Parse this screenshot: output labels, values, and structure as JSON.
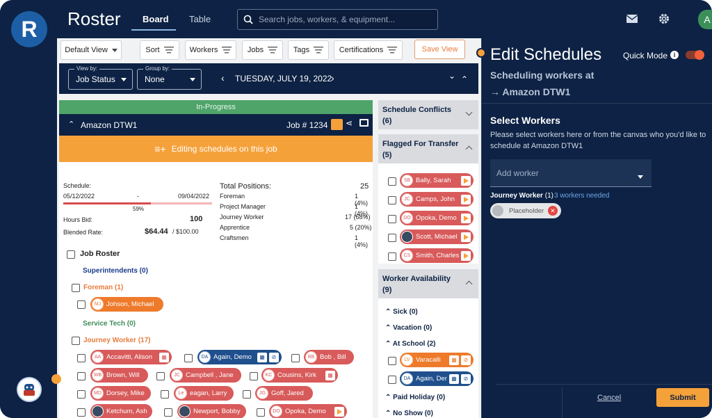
{
  "app": {
    "logo_letter": "R",
    "title": "Roster",
    "tabs": [
      "Board",
      "Table"
    ],
    "search_placeholder": "Search jobs, workers, & equipment...",
    "avatar_letter": "A"
  },
  "filters": {
    "default_view": "Default View",
    "sort": "Sort",
    "workers": "Workers",
    "jobs": "Jobs",
    "tags": "Tags",
    "certifications": "Certifications",
    "save_view": "Save View"
  },
  "nav": {
    "view_by_caption": "View by:",
    "view_by_value": "Job Status",
    "group_by_caption": "Group by:",
    "group_by_value": "None",
    "date": "TUESDAY, JULY 19, 2022"
  },
  "job": {
    "status": "In-Progress",
    "name": "Amazon DTW1",
    "number": "Job # 1234",
    "editing": "Editing schedules on this job",
    "schedule_label": "Schedule:",
    "start": "05/12/2022",
    "dash": "-",
    "end": "09/04/2022",
    "progress_pct": "59%",
    "progress": 0.59,
    "hours_bid_label": "Hours Bid:",
    "hours_bid": "100",
    "blended_label": "Blended Rate:",
    "blended_value": "$64.44",
    "blended_rest": "/ $100.00",
    "positions_label": "Total Positions:",
    "positions_total": "25",
    "positions": [
      {
        "name": "Foreman",
        "value": "1 (4%)"
      },
      {
        "name": "Project Manager",
        "value": "1 (4%)"
      },
      {
        "name": "Journey Worker",
        "value": "17 (68%)"
      },
      {
        "name": "Apprentice",
        "value": "5 (20%)"
      },
      {
        "name": "Craftsmen",
        "value": "1 (4%)"
      }
    ]
  },
  "roster": {
    "title": "Job Roster",
    "superintendents": "Superintendents (0)",
    "foreman": "Foreman (1)",
    "foreman_worker": {
      "initials": "MJ",
      "name": "Johson, Michael"
    },
    "service_tech": "Service Tech (0)",
    "journey": "Journey Worker (17)",
    "rows": [
      [
        {
          "initials": "AA",
          "name": "Accavitti, Alison"
        },
        {
          "initials": "DA",
          "name": "Again, Demo"
        },
        {
          "initials": "BB",
          "name": "Bob , Bill"
        }
      ],
      [
        {
          "initials": "WB",
          "name": "Brown, Will"
        },
        {
          "initials": "JC",
          "name": "Campbell , Jane"
        },
        {
          "initials": "KC",
          "name": "Cousins, Kirk"
        }
      ],
      [
        {
          "initials": "MD",
          "name": "Dorsey, Mike"
        },
        {
          "initials": "Le",
          "name": "eagan, Larry"
        },
        {
          "initials": "JG",
          "name": "Goff, Jared"
        }
      ],
      [
        {
          "initials": "",
          "name": "Ketchum, Ash"
        },
        {
          "initials": "",
          "name": "Newport, Bobby"
        },
        {
          "initials": "DO",
          "name": "Opoka, Demo"
        }
      ]
    ]
  },
  "side": {
    "conflicts": "Schedule Conflicts\n(6)",
    "flagged": "Flagged For Transfer\n(5)",
    "flagged_workers": [
      {
        "initials": "SB",
        "name": "Bally, Sarah"
      },
      {
        "initials": "JC",
        "name": "Camps, John"
      },
      {
        "initials": "DO",
        "name": "Opoka, Demo"
      },
      {
        "initials": "",
        "name": "Scott, Michael"
      },
      {
        "initials": "CS",
        "name": "Smith, Charles"
      }
    ],
    "availability": "Worker Availability\n(9)",
    "sick": "Sick (0)",
    "vacation": "Vacation (0)",
    "school": "At School (2)",
    "school_workers": [
      {
        "initials": "LV",
        "name": "Varacalli"
      },
      {
        "initials": "DA",
        "name": "Again, Demo"
      }
    ],
    "paid_holiday": "Paid Holiday (0)",
    "no_show": "No Show (0)"
  },
  "edit": {
    "title": "Edit Schedules",
    "quick_mode": "Quick Mode",
    "info": "i",
    "sub1": "Scheduling workers at",
    "sub2": "→ Amazon DTW1",
    "select_title": "Select Workers",
    "select_desc": "Please select workers here or from the canvas who you'd like to schedule at Amazon DTW1",
    "add_worker": "Add worker",
    "journey_label": "Journey Worker",
    "journey_count": "(1)",
    "needed": "3 workers needed",
    "placeholder": "Placeholder",
    "cancel": "Cancel",
    "submit": "Submit"
  },
  "colors": {
    "navy": "#0d2244",
    "orange": "#f5a13a",
    "green": "#4fa46a",
    "red_chip": "#d85a5a",
    "orange_chip": "#ee7a2b",
    "blue_chip": "#1f4f8c"
  },
  "icons": [
    "envelope-icon",
    "gear-icon",
    "search-icon",
    "flag-icon",
    "calendar-icon",
    "ban-icon",
    "share-icon",
    "chat-icon"
  ]
}
